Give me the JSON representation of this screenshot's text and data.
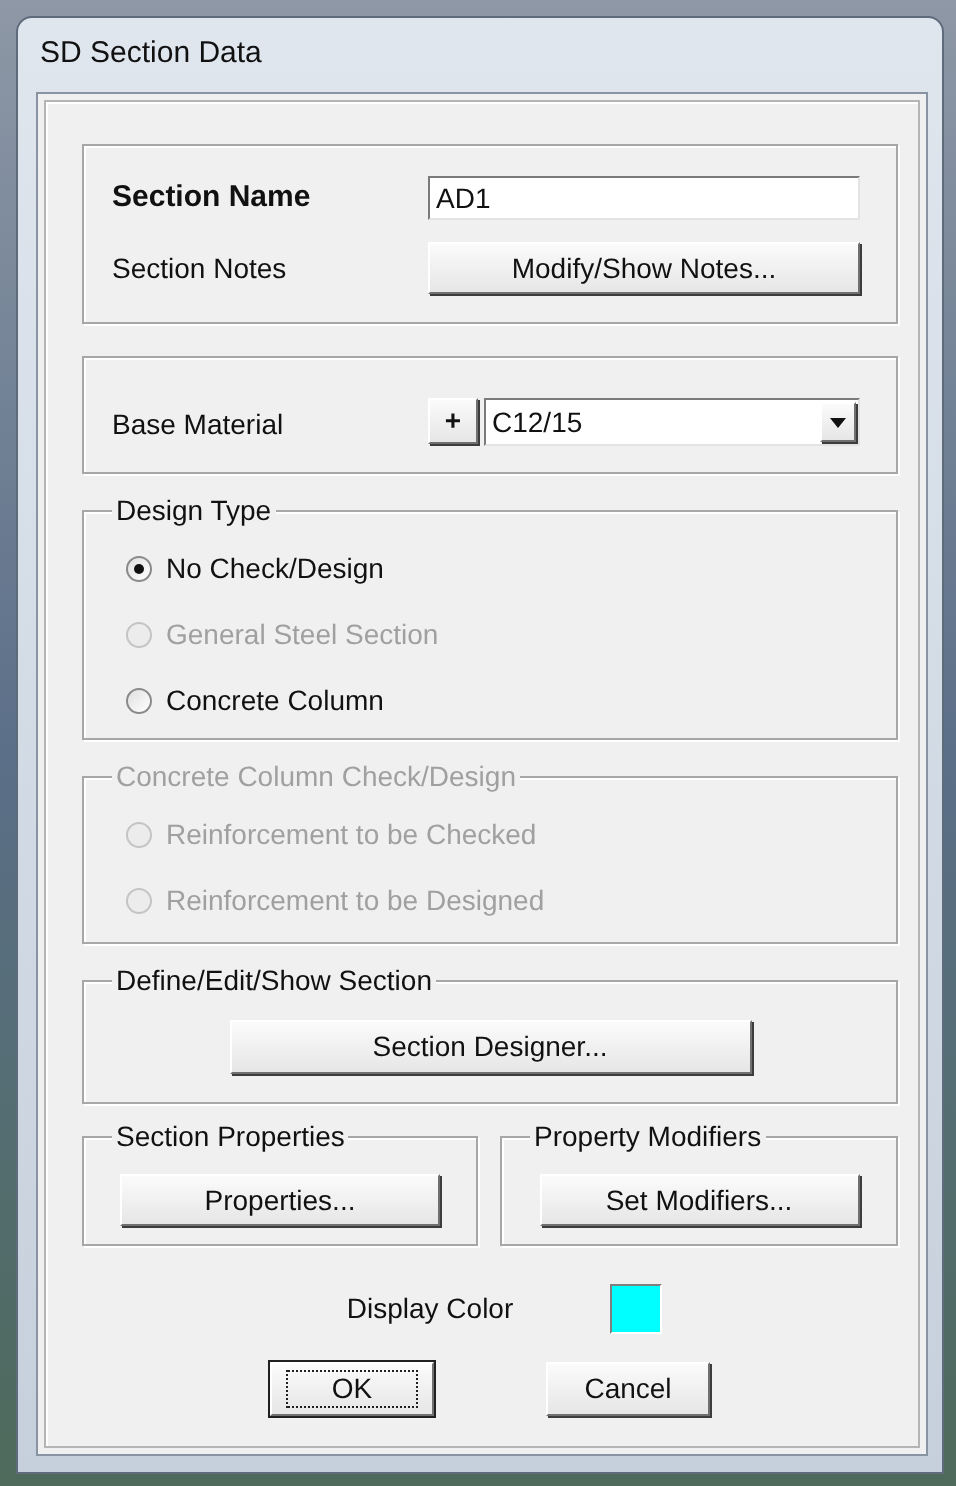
{
  "window": {
    "title": "SD Section Data"
  },
  "section_name": {
    "label": "Section Name",
    "value": "AD1"
  },
  "section_notes": {
    "label": "Section Notes",
    "button": "Modify/Show Notes..."
  },
  "base_material": {
    "label": "Base Material",
    "add_button": "+",
    "value": "C12/15"
  },
  "design_type": {
    "title": "Design Type",
    "disabled": false,
    "options": [
      {
        "label": "No Check/Design",
        "selected": true,
        "disabled": false
      },
      {
        "label": "General Steel Section",
        "selected": false,
        "disabled": true
      },
      {
        "label": "Concrete Column",
        "selected": false,
        "disabled": false
      }
    ]
  },
  "concrete_column_check": {
    "title": "Concrete Column Check/Design",
    "disabled": true,
    "options": [
      {
        "label": "Reinforcement to be Checked",
        "selected": false,
        "disabled": true
      },
      {
        "label": "Reinforcement to be Designed",
        "selected": false,
        "disabled": true
      }
    ]
  },
  "define_section": {
    "title": "Define/Edit/Show Section",
    "button": "Section Designer..."
  },
  "section_properties": {
    "title": "Section Properties",
    "button": "Properties..."
  },
  "property_modifiers": {
    "title": "Property Modifiers",
    "button": "Set Modifiers..."
  },
  "display_color": {
    "label": "Display Color",
    "color": "#00ffff"
  },
  "buttons": [
    {
      "label": "OK",
      "focused": true
    },
    {
      "label": "Cancel",
      "focused": false
    }
  ]
}
